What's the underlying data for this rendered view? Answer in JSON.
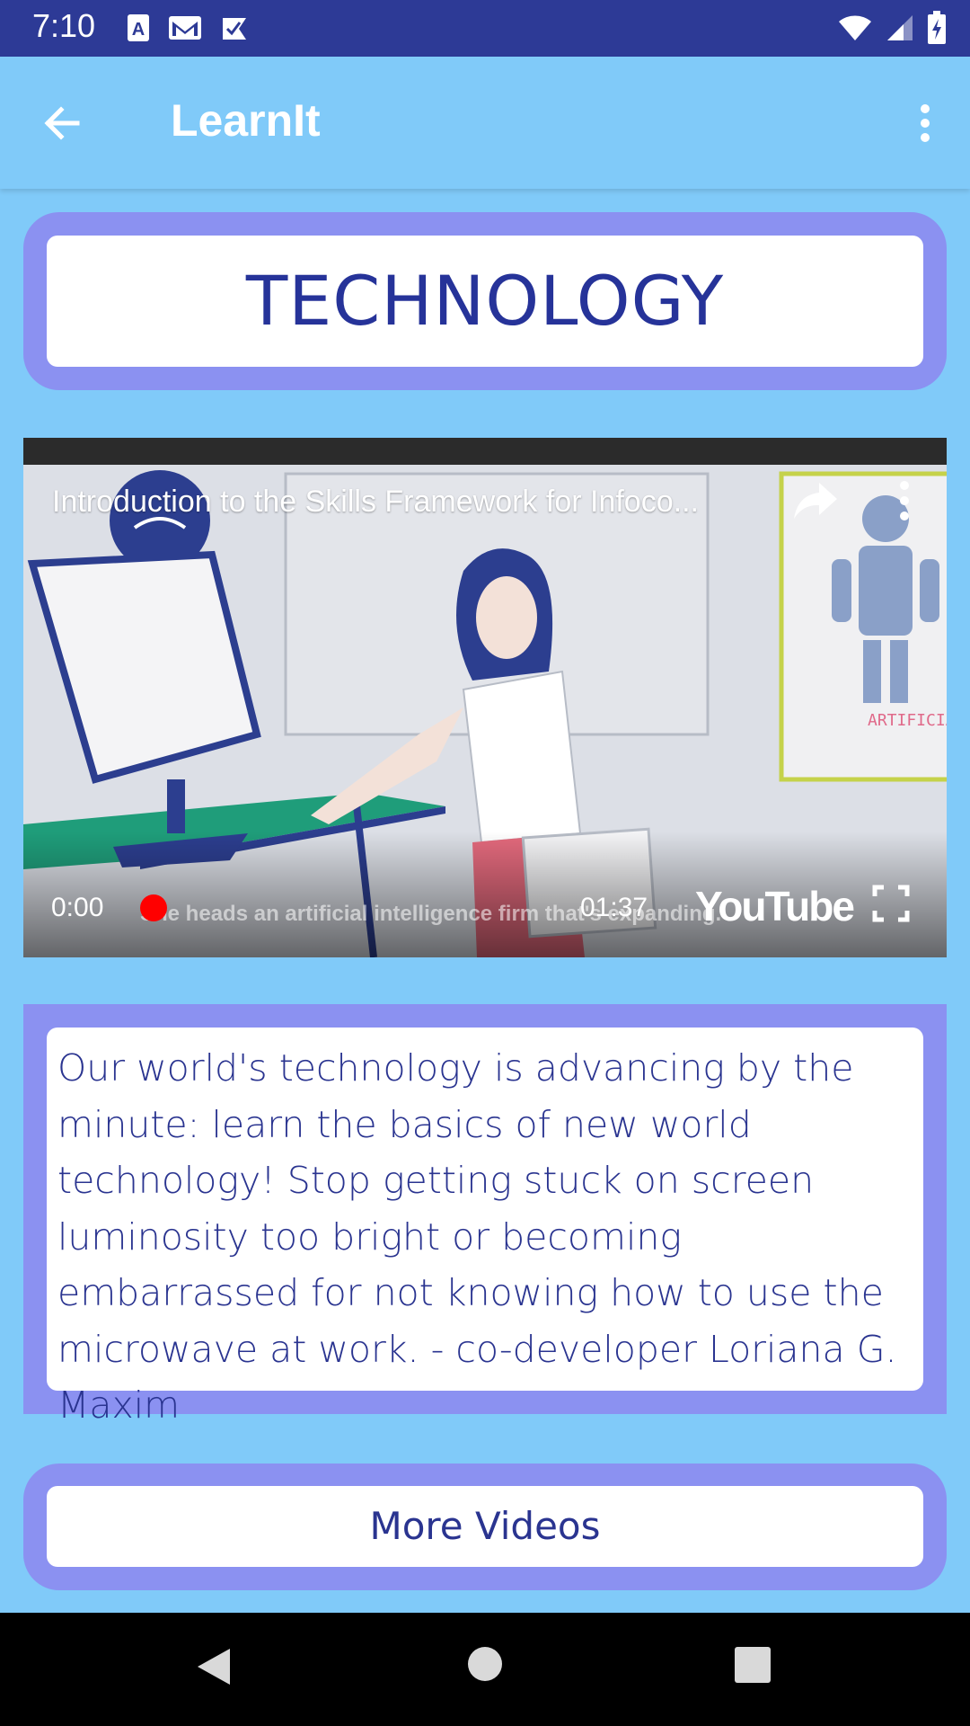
{
  "status_bar": {
    "time": "7:10",
    "icons": [
      "keyboard-a-icon",
      "gmail-icon",
      "task-check-icon",
      "wifi-icon",
      "signal-icon",
      "battery-icon"
    ]
  },
  "app_bar": {
    "title": "LearnIt",
    "back_icon": "arrow-back-icon",
    "menu_icon": "more-vert-icon"
  },
  "topic": {
    "title": "TECHNOLOGY"
  },
  "video": {
    "title": "Introduction to the Skills Framework for Infoco...",
    "current_time": "0:00",
    "duration": "01:37",
    "caption": "She heads an artificial intelligence firm that's expanding.",
    "brand": "YouTube",
    "poster_label": "ARTIFICIAL INTELLIGENCE",
    "progress": 0
  },
  "description": {
    "text": "Our world's technology is advancing by the minute: learn the basics of new world technology! Stop getting stuck on screen luminosity too bright or becoming embarrassed for not knowing how to use the microwave at work. - co-developer Loriana G. Maxim"
  },
  "more_button": {
    "label": "More Videos"
  },
  "colors": {
    "status_bar": "#2d3a96",
    "background": "#80caf9",
    "frame": "#8b91f1",
    "text": "#2a3490"
  }
}
